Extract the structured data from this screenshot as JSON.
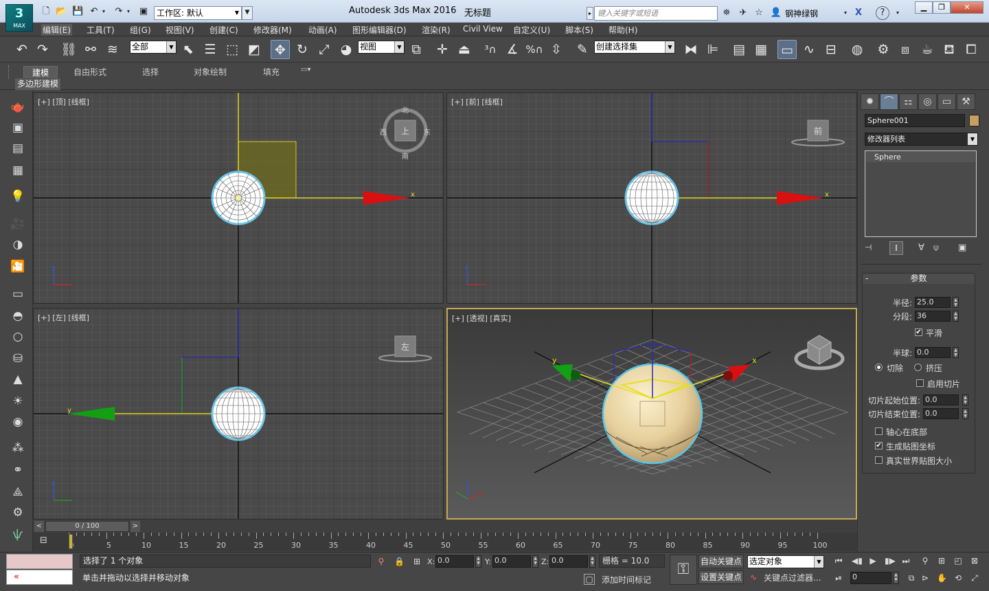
{
  "app": {
    "logo_text": "MAX",
    "title": "Autodesk 3ds Max 2016",
    "document": "无标题",
    "workspace": "工作区: 默认",
    "search_placeholder": "键入关键字或短语",
    "user": "钢神绿钢"
  },
  "menu": [
    "编辑(E)",
    "工具(T)",
    "组(G)",
    "视图(V)",
    "创建(C)",
    "修改器(M)",
    "动画(A)",
    "图形编辑器(D)",
    "渲染(R)",
    "Civil View",
    "自定义(U)",
    "脚本(S)",
    "帮助(H)"
  ],
  "toolbar": {
    "selection_filter": "全部",
    "ref_coord": "视图",
    "named_selection": "创建选择集"
  },
  "ribbon": {
    "tabs": [
      "建模",
      "自由形式",
      "选择",
      "对象绘制",
      "填充"
    ],
    "active_tab": "建模",
    "subpanel": "多边形建模"
  },
  "viewports": {
    "top": {
      "label": "[+] [顶] [线框]",
      "cube": "上",
      "north": "北",
      "south": "南",
      "east": "东",
      "west": "西"
    },
    "front": {
      "label": "[+] [前] [线框]",
      "cube": "前"
    },
    "left": {
      "label": "[+] [左] [线框]",
      "cube": "左"
    },
    "persp": {
      "label": "[+] [透视] [真实]"
    },
    "axis_x": "x",
    "axis_y": "y",
    "axis_z": "z"
  },
  "command_panel": {
    "object_name": "Sphere001",
    "object_color": "#c7a060",
    "modifier_list": "修改器列表",
    "stack_item": "Sphere",
    "rollout_title": "参数",
    "radius_label": "半径:",
    "radius": "25.0",
    "segments_label": "分段:",
    "segments": "36",
    "smooth_label": "平滑",
    "hemisphere_label": "半球:",
    "hemisphere": "0.0",
    "chop_label": "切除",
    "squash_label": "挤压",
    "slice_on_label": "启用切片",
    "slice_from_label": "切片起始位置:",
    "slice_from": "0.0",
    "slice_to_label": "切片结束位置:",
    "slice_to": "0.0",
    "base_to_pivot_label": "轴心在底部",
    "gen_mapping_label": "生成贴图坐标",
    "real_world_label": "真实世界贴图大小"
  },
  "timeline": {
    "frame": "0 / 100",
    "ticks": [
      "0",
      "5",
      "10",
      "15",
      "20",
      "25",
      "30",
      "35",
      "40",
      "45",
      "50",
      "55",
      "60",
      "65",
      "70",
      "75",
      "80",
      "85",
      "90",
      "95",
      "100"
    ]
  },
  "status": {
    "selection": "选择了 1 个对象",
    "prompt": "单击并拖动以选择并移动对象",
    "x_label": "X:",
    "x": "0.0",
    "y_label": "Y:",
    "y": "0.0",
    "z_label": "Z:",
    "z": "0.0",
    "grid": "栅格 = 10.0",
    "add_time_tag": "添加时间标记",
    "auto_key": "自动关键点",
    "set_key": "设置关键点",
    "selected_objects": "选定对象",
    "key_filters": "关键点过滤器...",
    "current_frame": "0"
  }
}
